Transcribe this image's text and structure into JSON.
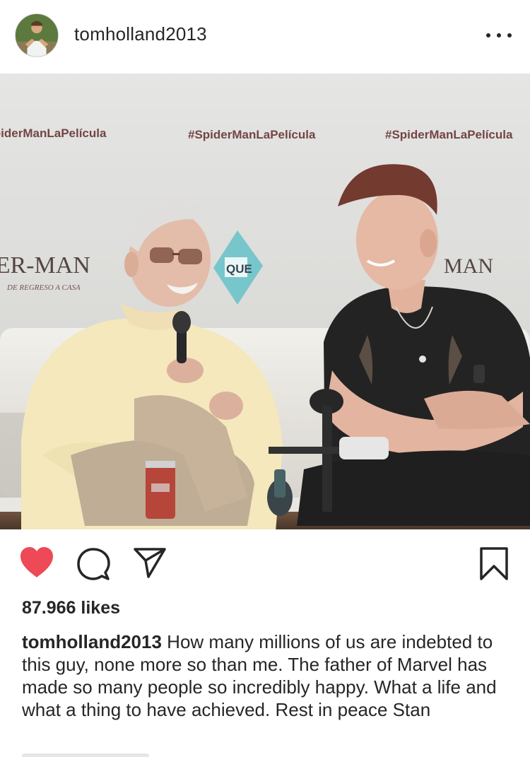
{
  "header": {
    "username": "tomholland2013"
  },
  "photo": {
    "backdrop_hashtags": [
      "#SpiderManLaPelícula",
      "#SpiderManLaPelícula",
      "#SpiderManLaPelícula"
    ],
    "logo_left": "SPIDER-MAN",
    "logo_left_sub": "DE REGRESO A CASA",
    "logo_right": "MAN",
    "bubble_text": "QUE"
  },
  "actions": {
    "liked": true,
    "like_color": "#ed4956"
  },
  "likes": {
    "text": "87.966 likes"
  },
  "caption": {
    "username": "tomholland2013",
    "text": "How many millions of us are indebted to this guy, none more so than me. The father of Marvel has made so many people so incredibly happy. What a life and what a thing to have achieved. Rest in peace Stan"
  },
  "icons": {
    "more": "more-dots-icon",
    "like": "heart-icon",
    "comment": "comment-icon",
    "share": "share-icon",
    "save": "bookmark-icon"
  }
}
